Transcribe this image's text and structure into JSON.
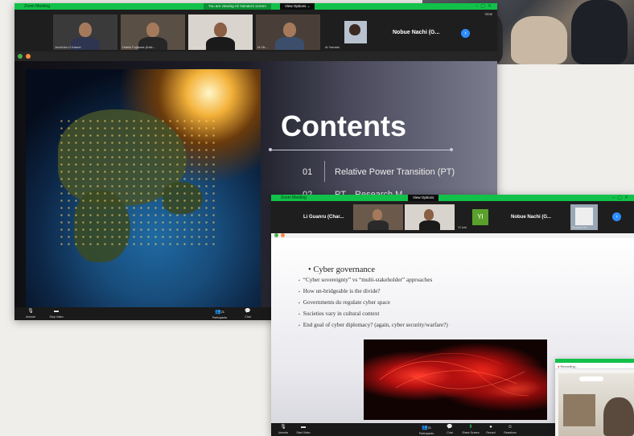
{
  "window1": {
    "title": "Zoom Meeting",
    "notice": "You are viewing Ali Yamato's screen",
    "view_options": "View Options ⌄",
    "view_label": "View",
    "participants": [
      {
        "label": "Junichiro U Kamei"
      },
      {
        "label": "Hideki Fujiwara (Kaik..."
      },
      {
        "label": "Yanagishi..."
      },
      {
        "label": "M.Ok..."
      },
      {
        "label": "Ai Yamato"
      }
    ],
    "active_name": "Nobue Nachi (G...",
    "slide": {
      "title": "Contents",
      "items": [
        {
          "num": "01",
          "text": "Relative Power Transition (PT)"
        },
        {
          "num": "02",
          "text": "PT... Research M..."
        }
      ]
    },
    "toolbar": {
      "unmute": "Unmute",
      "stop_video": "Stop Video",
      "participants": "Participants",
      "participants_count": "21",
      "chat": "Chat"
    }
  },
  "window2": {
    "title": "Zoom Meeting",
    "view_options": "View Options",
    "participants": [
      {
        "label": "Li Guanru (Char..."
      },
      {
        "label": ""
      },
      {
        "label": ""
      },
      {
        "label": "Yl Ichi"
      },
      {
        "label": "Nobue Nachi (G..."
      },
      {
        "label": "Masaki Ab..."
      }
    ],
    "yi_initials": "YI",
    "slide": {
      "heading": "Cyber governance",
      "bullets": [
        "“Cyber sovereignty” vs “multi-stakeholder” approaches",
        "How un-bridgeable is the divide?",
        "Governments do regulate cyber space",
        "Societies vary in cultural context",
        "End goal of cyber diplomacy? (again, cyber security/warfare?)"
      ]
    },
    "toolbar": {
      "unmute": "Unmute",
      "stop_video": "Start Video",
      "participants": "Participants",
      "participants_count": "21",
      "chat": "Chat",
      "share_screen": "Share Screen",
      "record": "Record",
      "reactions": "Reactions"
    }
  },
  "window3": {
    "title": "Zoom",
    "bar": "Recording..."
  },
  "colors": {
    "zoom_green": "#12c14a",
    "zoom_blue": "#2d8cff",
    "yi_tile": "#5aa02c"
  }
}
